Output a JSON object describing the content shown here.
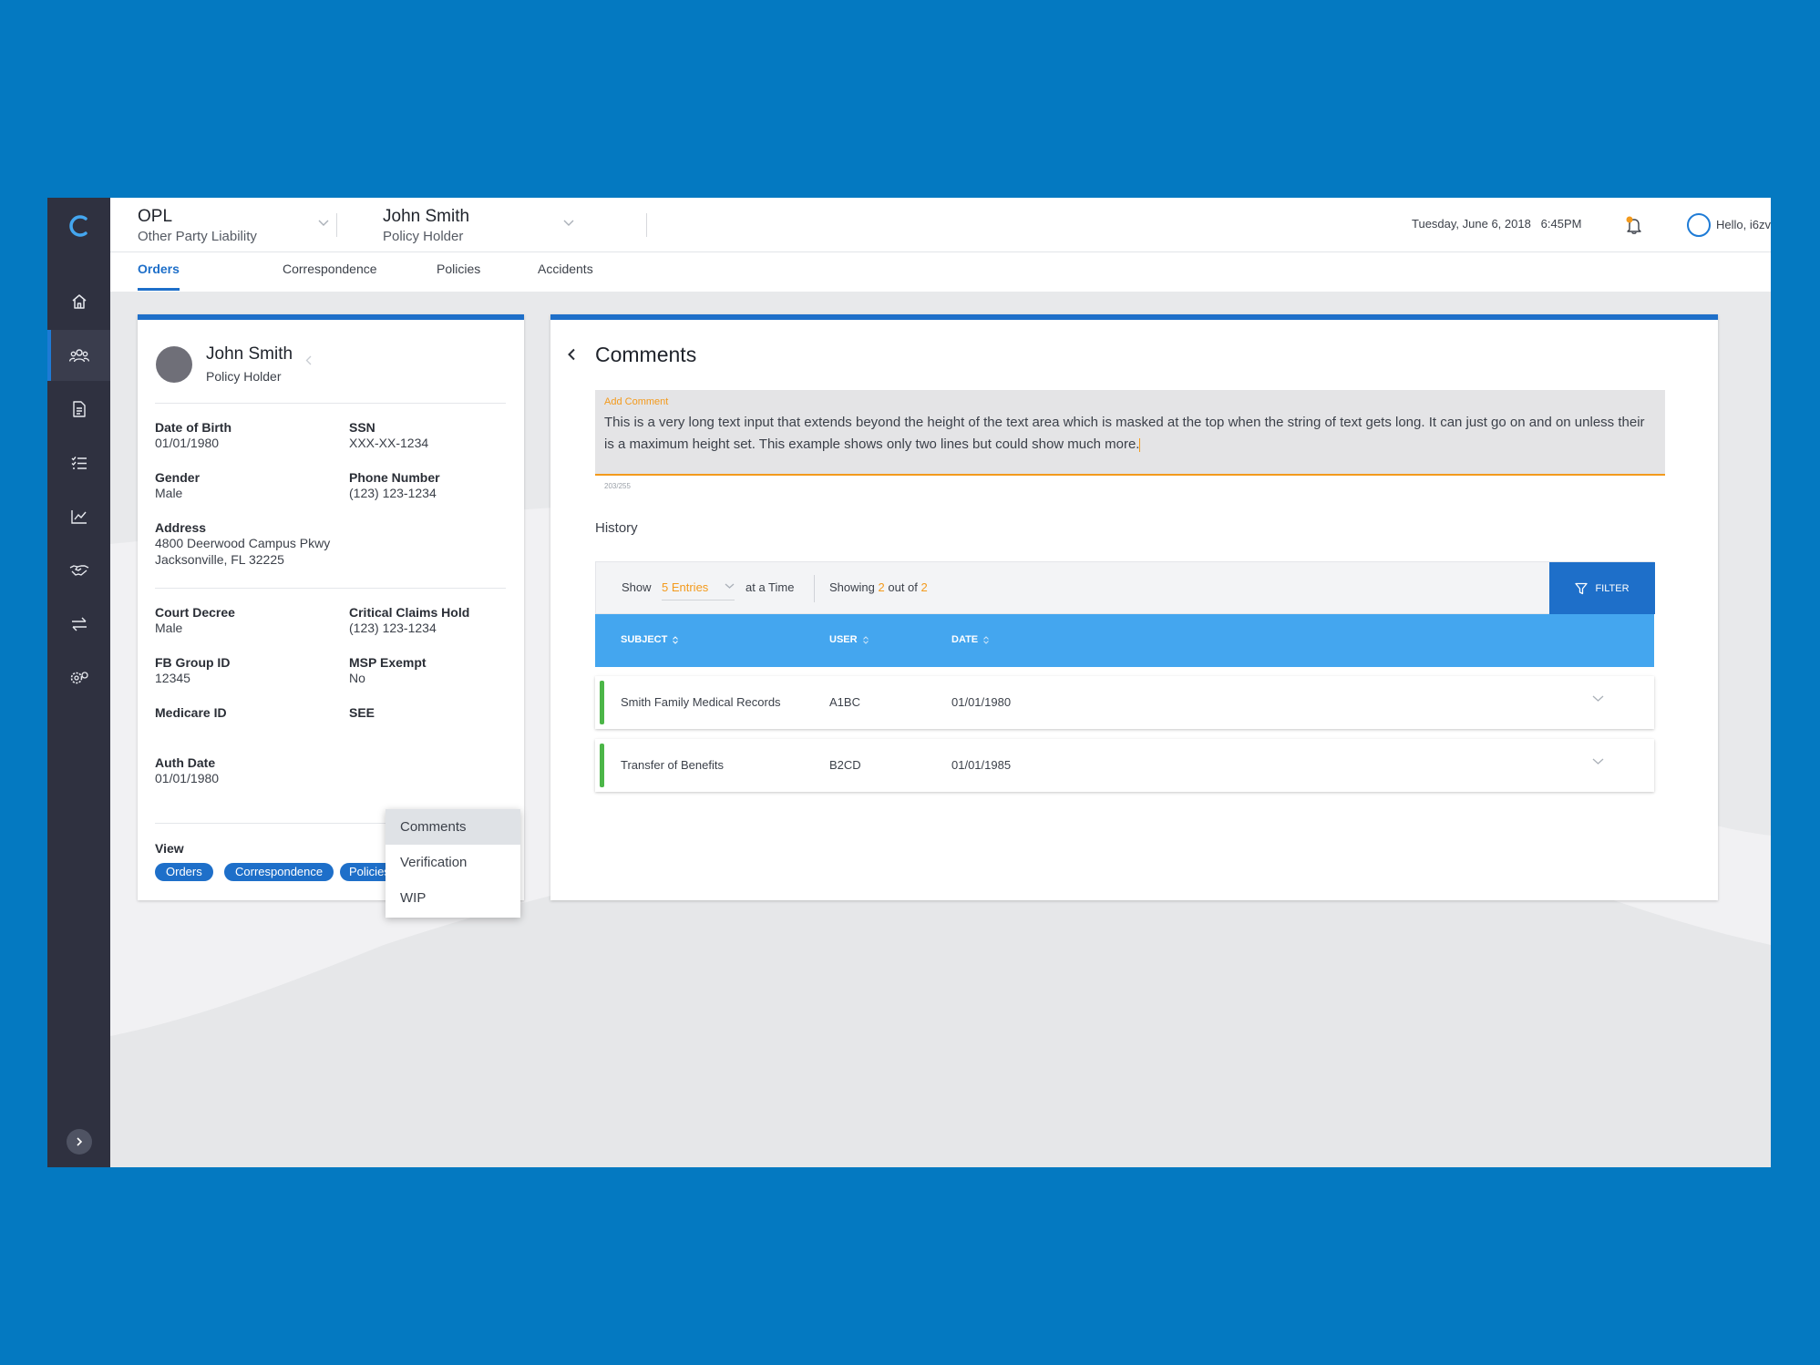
{
  "header": {
    "context1": {
      "title": "OPL",
      "subtitle": "Other Party Liability"
    },
    "context2": {
      "title": "John Smith",
      "subtitle": "Policy Holder"
    },
    "date": "Tuesday, June 6, 2018",
    "time": "6:45PM",
    "greeting": "Hello, i6zv"
  },
  "tabs": [
    "Orders",
    "Correspondence",
    "Policies",
    "Accidents"
  ],
  "active_tab": "Orders",
  "sidebar": {
    "icons": [
      "home-icon",
      "people-icon",
      "document-icon",
      "checklist-icon",
      "chart-icon",
      "handshake-icon",
      "transfer-icon",
      "settings-icon"
    ],
    "active": "people-icon"
  },
  "profile": {
    "name": "John Smith",
    "role": "Policy Holder",
    "fields": [
      {
        "label": "Date of Birth",
        "value": "01/01/1980"
      },
      {
        "label": "SSN",
        "value": "XXX-XX-1234"
      },
      {
        "label": "Gender",
        "value": "Male"
      },
      {
        "label": "Phone Number",
        "value": "(123) 123-1234"
      },
      {
        "label": "Address",
        "value": "4800 Deerwood Campus Pkwy",
        "value2": "Jacksonville, FL 32225"
      },
      {
        "label": "Court Decree",
        "value": "Male"
      },
      {
        "label": "Critical Claims Hold",
        "value": "(123) 123-1234"
      },
      {
        "label": "FB Group ID",
        "value": "12345"
      },
      {
        "label": "MSP Exempt",
        "value": "No"
      },
      {
        "label": "Medicare ID",
        "value": ""
      },
      {
        "label": "SEE",
        "value": ""
      },
      {
        "label": "Auth Date",
        "value": "01/01/1980"
      }
    ],
    "view_label": "View",
    "view_chips": [
      "Orders",
      "Correspondence",
      "Policies"
    ],
    "menu": [
      "Comments",
      "Verification",
      "WIP"
    ],
    "menu_highlight": "Comments"
  },
  "comments": {
    "title": "Comments",
    "input_label": "Add Comment",
    "input_value": "This is a very long text input that extends beyond the height of the text area which is masked at the top when the string of text gets long. It can just go on and on unless their is a maximum height set. This example shows only two lines but could show much more.",
    "char_count": "203/255",
    "history_label": "History",
    "toolbar": {
      "show": "Show",
      "entries": "5 Entries",
      "at_a_time": "at a Time",
      "showing": "Showing",
      "showing_count": "2",
      "out_of": "out of",
      "total": "2",
      "filter": "FILTER"
    },
    "columns": [
      "SUBJECT",
      "USER",
      "DATE"
    ],
    "rows": [
      {
        "subject": "Smith Family Medical Records",
        "user": "A1BC",
        "date": "01/01/1980"
      },
      {
        "subject": "Transfer of Benefits",
        "user": "B2CD",
        "date": "01/01/1985"
      }
    ]
  },
  "colors": {
    "background": "#0479c1",
    "sidebar": "#2f3140",
    "primary": "#1e6fc9",
    "table_header": "#44a6ef",
    "accent": "#f39a1c",
    "status_green": "#4cb648"
  }
}
